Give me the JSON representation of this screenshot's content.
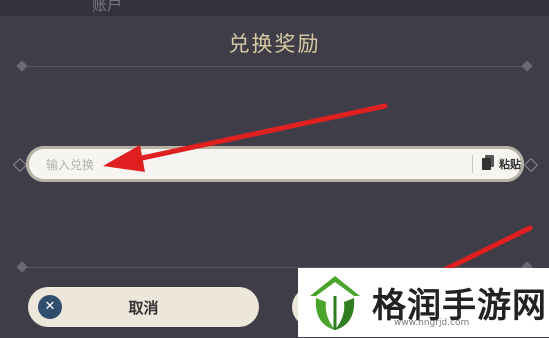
{
  "background": {
    "account_label": "账户"
  },
  "dialog": {
    "title": "兑换奖励",
    "code_input": {
      "placeholder": "输入兑换",
      "value": ""
    },
    "paste_label": "粘贴",
    "cancel_label": "取消"
  },
  "colors": {
    "background": "#3e3d48",
    "title": "#d6c9a3",
    "button": "#ece7da",
    "cancel_icon": "#2f4e6e",
    "annotation_arrow": "#e02020"
  },
  "icons": {
    "cancel": "close-icon",
    "paste": "clipboard-icon"
  },
  "watermark": {
    "name": "格润手游网",
    "url": "www.hngrjd.com"
  }
}
